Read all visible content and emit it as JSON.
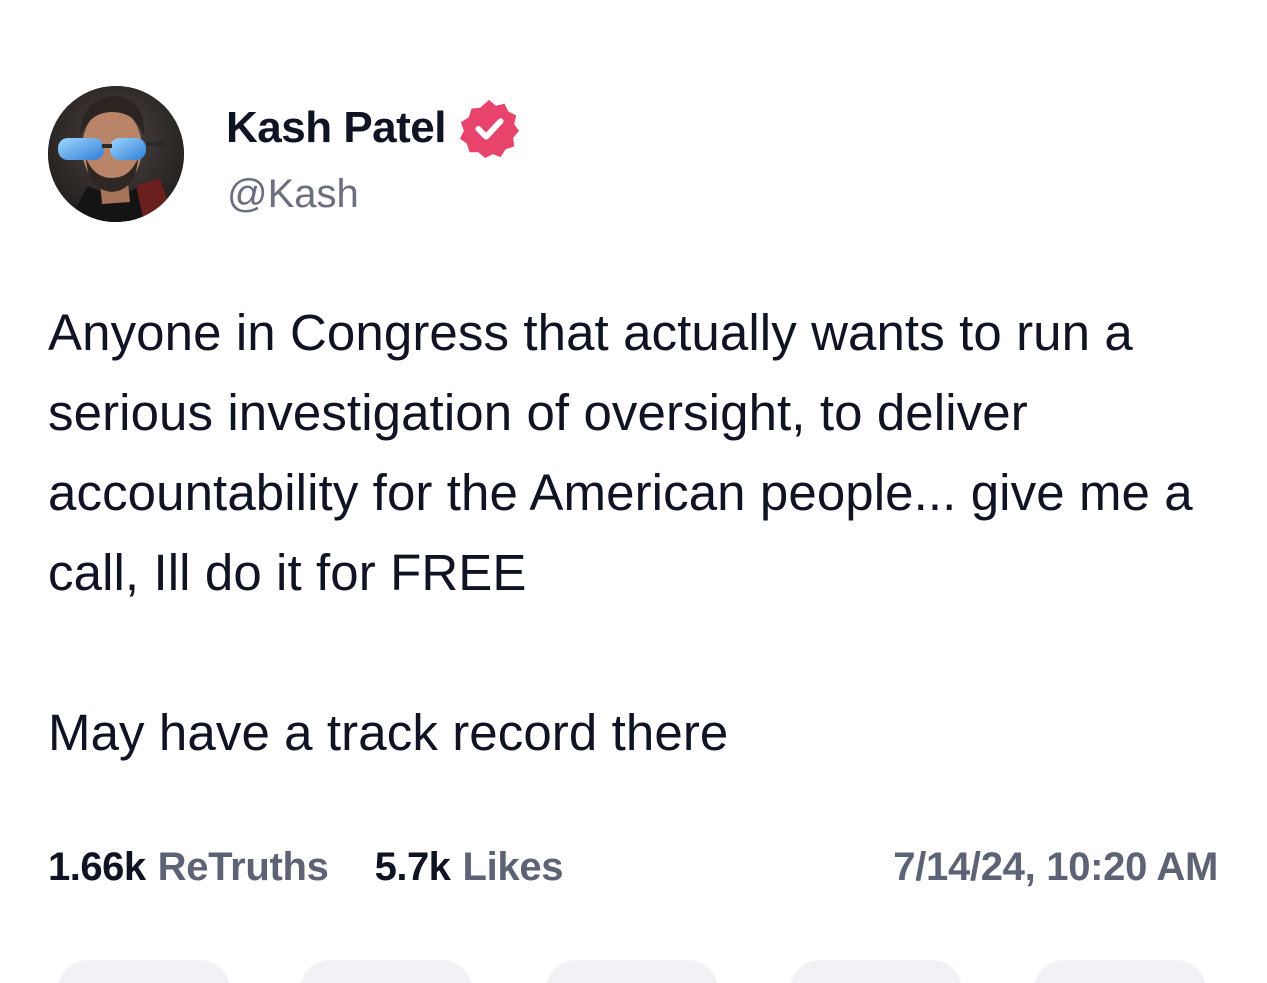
{
  "author": {
    "display_name": "Kash Patel",
    "handle": "@Kash",
    "verified": true,
    "badge_color": "#e8436a"
  },
  "post": {
    "paragraph_1": "Anyone in Congress that actually wants to run a serious investigation of oversight, to deliver accountability for the American people... give me a call, Ill do it for FREE",
    "paragraph_2": "May have a track record there"
  },
  "stats": {
    "retruths_count": "1.66k",
    "retruths_label": "ReTruths",
    "likes_count": "5.7k",
    "likes_label": "Likes",
    "timestamp": "7/14/24, 10:20 AM"
  },
  "icons": {
    "avatar": "profile-photo",
    "badge": "verified-badge-icon"
  }
}
